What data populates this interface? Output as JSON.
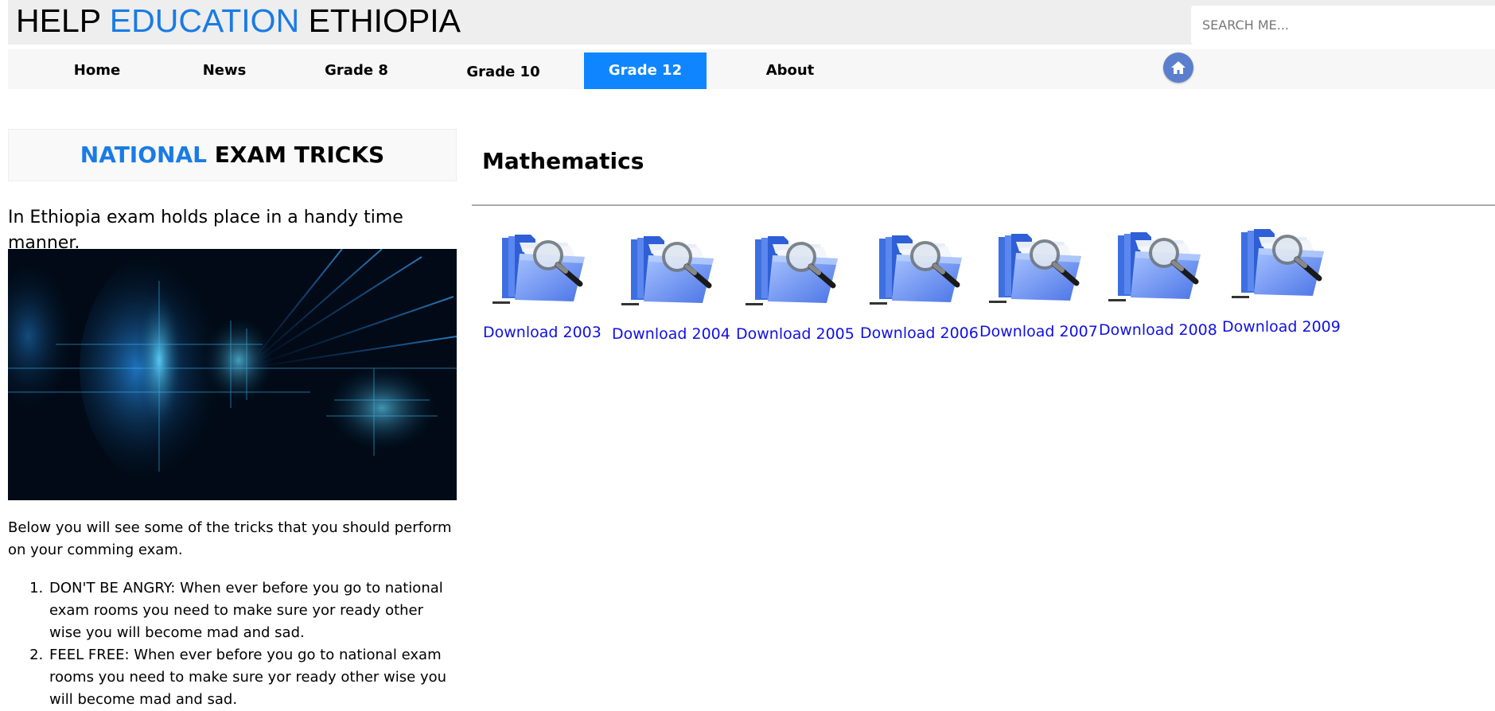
{
  "header": {
    "logo_part1": "HELP ",
    "logo_part2": "EDUCATION",
    "logo_part3": " ETHIOPIA",
    "search_placeholder": "SEARCH ME..."
  },
  "nav": {
    "items": [
      {
        "label": "Home",
        "active": false
      },
      {
        "label": "News",
        "active": false
      },
      {
        "label": "Grade 8",
        "active": false
      },
      {
        "label": "Grade 10",
        "active": false
      },
      {
        "label": "Grade 12",
        "active": true
      },
      {
        "label": "About",
        "active": false
      }
    ],
    "home_icon": "home-icon"
  },
  "sidebar": {
    "title_highlight": "NATIONAL",
    "title_rest": " EXAM TRICKS",
    "intro": "In Ethiopia exam holds place in a handy time manner.",
    "body": "Below you will see some of the tricks that you should perform on your comming exam.",
    "tricks": [
      "DON'T BE ANGRY: When ever before you go to national exam rooms you need to make sure yor ready other wise you will become mad and sad.",
      "FEEL FREE: When ever before you go to national exam rooms you need to make sure yor ready other wise you will become mad and sad."
    ]
  },
  "main": {
    "section_title": "Mathematics",
    "downloads": [
      {
        "label": "Download 2003",
        "icon": "folder-search-icon"
      },
      {
        "label": "Download 2004",
        "icon": "folder-search-icon"
      },
      {
        "label": "Download 2005",
        "icon": "folder-search-icon"
      },
      {
        "label": "Download 2006",
        "icon": "folder-search-icon"
      },
      {
        "label": "Download 2007",
        "icon": "folder-search-icon"
      },
      {
        "label": "Download 2008",
        "icon": "folder-search-icon"
      },
      {
        "label": "Download 2009",
        "icon": "folder-search-icon"
      }
    ]
  },
  "colors": {
    "accent_blue": "#1a7be5",
    "active_nav": "#0f86ff",
    "link_blue": "#1010e6"
  }
}
